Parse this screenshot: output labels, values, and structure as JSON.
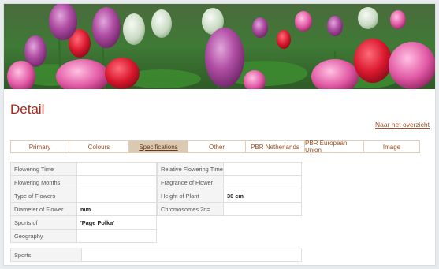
{
  "page": {
    "title": "Detail",
    "overview_link": "Naar het overzicht"
  },
  "tabs": [
    {
      "label": "Primary",
      "active": false
    },
    {
      "label": "Colours",
      "active": false
    },
    {
      "label": "Specifications",
      "active": true
    },
    {
      "label": "Other",
      "active": false
    },
    {
      "label": "PBR Netherlands",
      "active": false
    },
    {
      "label": "PBR European Union",
      "active": false
    },
    {
      "label": "Image",
      "active": false
    }
  ],
  "left_table": [
    {
      "label": "Flowering Time",
      "value": ""
    },
    {
      "label": "Flowering Months",
      "value": ""
    },
    {
      "label": "Type of Flowers",
      "value": ""
    },
    {
      "label": "Diameter of Flower",
      "value": "mm"
    },
    {
      "label": "Sports of",
      "value": "'Page Polka'"
    },
    {
      "label": "Geography",
      "value": ""
    }
  ],
  "right_table": [
    {
      "label": "Relative Flowering Time",
      "value": ""
    },
    {
      "label": "Fragrance of Flower",
      "value": ""
    },
    {
      "label": "Height of Plant",
      "value": "30 cm"
    },
    {
      "label": "Chromosomes 2n=",
      "value": ""
    }
  ],
  "sports": {
    "label": "Sports",
    "value": ""
  },
  "colors": {
    "title": "#a5281f",
    "tab_active_bg": "#dcc9b2",
    "tab_text": "#9a4d22"
  }
}
